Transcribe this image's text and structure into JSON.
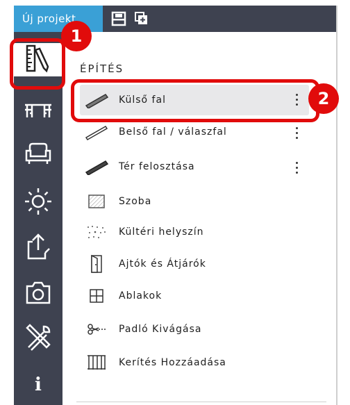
{
  "header": {
    "project_tab": "Új projekt",
    "icons": [
      "save-icon",
      "copy-icon"
    ]
  },
  "sidebar": {
    "items": [
      {
        "icon": "ruler-pencil-icon",
        "active": true
      },
      {
        "icon": "furniture-icon",
        "active": false
      },
      {
        "icon": "sofa-icon",
        "active": false
      },
      {
        "icon": "sun-icon",
        "active": false
      },
      {
        "icon": "export-icon",
        "active": false
      },
      {
        "icon": "camera-icon",
        "active": false
      },
      {
        "icon": "tools-icon",
        "active": false
      },
      {
        "icon": "info-icon",
        "active": false
      }
    ],
    "info_label": "i"
  },
  "panel": {
    "section_title": "ÉPÍTÉS",
    "items": [
      {
        "label": "Külső fal",
        "icon": "wall-icon",
        "selected": true,
        "menu": true
      },
      {
        "label": "Belső fal / válaszfal",
        "icon": "inner-wall-icon",
        "selected": false,
        "menu": true
      },
      {
        "label": "Tér felosztása",
        "icon": "space-divider-icon",
        "selected": false,
        "menu": true
      },
      {
        "label": "Szoba",
        "icon": "room-icon",
        "selected": false,
        "menu": false
      },
      {
        "label": "Kültéri helyszín",
        "icon": "outdoor-icon",
        "selected": false,
        "menu": false
      },
      {
        "label": "Ajtók és Átjárók",
        "icon": "door-icon",
        "selected": false,
        "menu": false
      },
      {
        "label": "Ablakok",
        "icon": "window-icon",
        "selected": false,
        "menu": false
      },
      {
        "label": "Padló Kivágása",
        "icon": "floor-cut-icon",
        "selected": false,
        "menu": false
      },
      {
        "label": "Kerítés Hozzáadása",
        "icon": "fence-icon",
        "selected": false,
        "menu": false
      }
    ]
  },
  "callouts": [
    {
      "number": "1"
    },
    {
      "number": "2"
    }
  ],
  "colors": {
    "accent": "#3aa0d6",
    "sidebar": "#3e4250",
    "highlight": "#e10b0b",
    "selected_row": "#e8e8ea"
  }
}
